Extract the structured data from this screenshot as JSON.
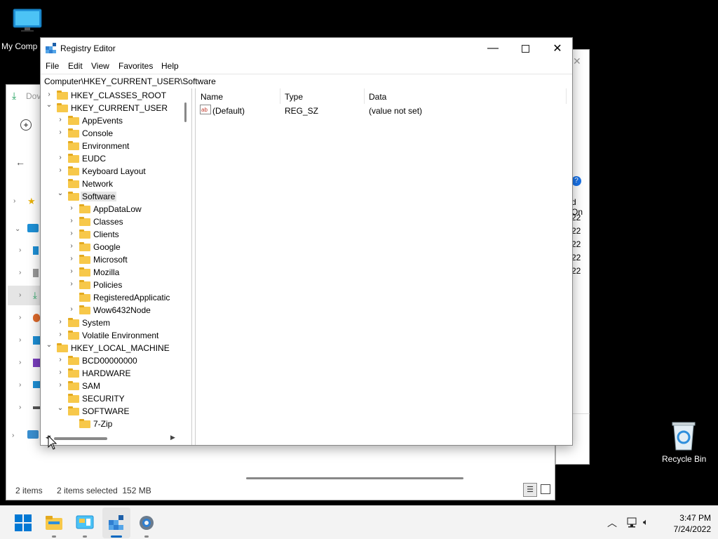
{
  "desktop": {
    "my_computer_label": "My Comp",
    "recycle_bin_label": "Recycle Bin"
  },
  "explorer": {
    "status_items": "2 items",
    "status_selected": "2 items selected  152 MB",
    "partial_toolbar_text": "Dov",
    "partial_col_header": "d On",
    "partial_dates": [
      "22",
      "22",
      "22",
      "22",
      "22"
    ]
  },
  "registry": {
    "title": "Registry Editor",
    "menu": [
      "File",
      "Edit",
      "View",
      "Favorites",
      "Help"
    ],
    "address": "Computer\\HKEY_CURRENT_USER\\Software",
    "tree": [
      {
        "label": "HKEY_CLASSES_ROOT",
        "level": 0,
        "chevron": ">",
        "selected": false
      },
      {
        "label": "HKEY_CURRENT_USER",
        "level": 0,
        "chevron": "v",
        "selected": false
      },
      {
        "label": "AppEvents",
        "level": 1,
        "chevron": ">",
        "selected": false
      },
      {
        "label": "Console",
        "level": 1,
        "chevron": ">",
        "selected": false
      },
      {
        "label": "Environment",
        "level": 1,
        "chevron": "",
        "selected": false
      },
      {
        "label": "EUDC",
        "level": 1,
        "chevron": ">",
        "selected": false
      },
      {
        "label": "Keyboard Layout",
        "level": 1,
        "chevron": ">",
        "selected": false
      },
      {
        "label": "Network",
        "level": 1,
        "chevron": "",
        "selected": false
      },
      {
        "label": "Software",
        "level": 1,
        "chevron": "v",
        "selected": true
      },
      {
        "label": "AppDataLow",
        "level": 2,
        "chevron": ">",
        "selected": false
      },
      {
        "label": "Classes",
        "level": 2,
        "chevron": ">",
        "selected": false
      },
      {
        "label": "Clients",
        "level": 2,
        "chevron": ">",
        "selected": false
      },
      {
        "label": "Google",
        "level": 2,
        "chevron": ">",
        "selected": false
      },
      {
        "label": "Microsoft",
        "level": 2,
        "chevron": ">",
        "selected": false
      },
      {
        "label": "Mozilla",
        "level": 2,
        "chevron": ">",
        "selected": false
      },
      {
        "label": "Policies",
        "level": 2,
        "chevron": ">",
        "selected": false
      },
      {
        "label": "RegisteredApplicatic",
        "level": 2,
        "chevron": "",
        "selected": false
      },
      {
        "label": "Wow6432Node",
        "level": 2,
        "chevron": ">",
        "selected": false
      },
      {
        "label": "System",
        "level": 1,
        "chevron": ">",
        "selected": false
      },
      {
        "label": "Volatile Environment",
        "level": 1,
        "chevron": ">",
        "selected": false
      },
      {
        "label": "HKEY_LOCAL_MACHINE",
        "level": 0,
        "chevron": "v",
        "selected": false
      },
      {
        "label": "BCD00000000",
        "level": 1,
        "chevron": ">",
        "selected": false
      },
      {
        "label": "HARDWARE",
        "level": 1,
        "chevron": ">",
        "selected": false
      },
      {
        "label": "SAM",
        "level": 1,
        "chevron": ">",
        "selected": false
      },
      {
        "label": "SECURITY",
        "level": 1,
        "chevron": "",
        "selected": false
      },
      {
        "label": "SOFTWARE",
        "level": 1,
        "chevron": "v",
        "selected": false
      },
      {
        "label": "7-Zip",
        "level": 2,
        "chevron": "",
        "selected": false
      }
    ],
    "columns": {
      "name": "Name",
      "type": "Type",
      "data": "Data"
    },
    "values": [
      {
        "name": "(Default)",
        "type": "REG_SZ",
        "data": "(value not set)"
      }
    ]
  },
  "taskbar": {
    "time": "3:47 PM",
    "date": "7/24/2022"
  },
  "colors": {
    "folder": "#f7c84a",
    "accent": "#0067c0"
  }
}
